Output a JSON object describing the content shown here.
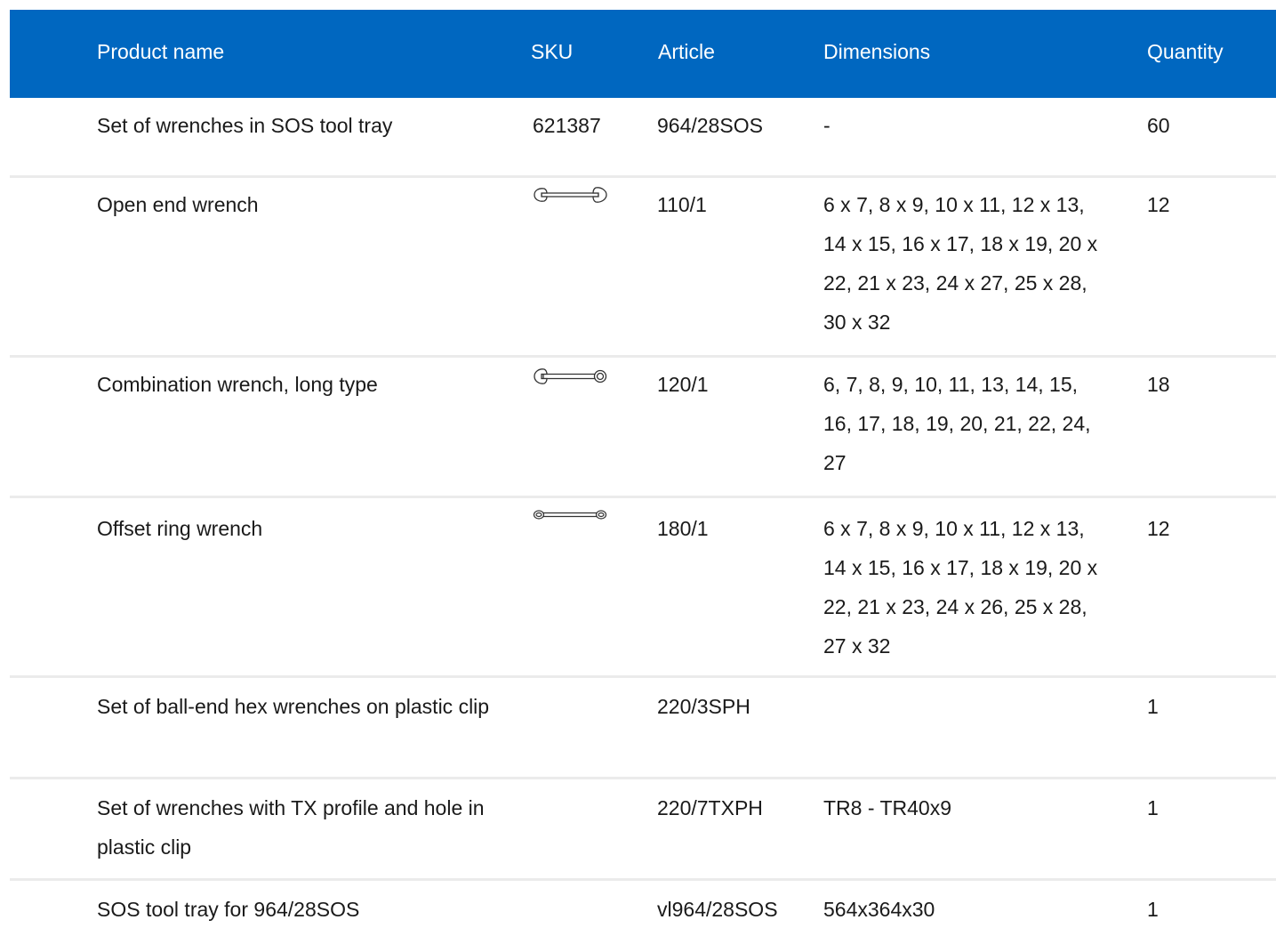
{
  "header": {
    "product_name": "Product name",
    "sku": "SKU",
    "article": "Article",
    "dimensions": "Dimensions",
    "quantity": "Quantity"
  },
  "colors": {
    "header_bg": "#0067c0",
    "header_text": "#ffffff",
    "row_divider": "#ebebeb"
  },
  "rows": [
    {
      "product_name": "Set of wrenches in SOS tool tray",
      "sku": "621387",
      "article": "964/28SOS",
      "dimensions": "-",
      "quantity": "60"
    },
    {
      "product_name": "Open end wrench",
      "sku_icon": "open-end-wrench-icon",
      "article": "110/1",
      "dimensions": "6 x 7, 8 x 9, 10 x 11, 12 x 13, 14 x 15, 16 x 17, 18 x 19, 20 x 22, 21 x 23, 24 x 27, 25 x 28, 30 x 32",
      "quantity": "12"
    },
    {
      "product_name": "Combination wrench, long type",
      "sku_icon": "combination-wrench-icon",
      "article": "120/1",
      "dimensions": "6, 7, 8, 9, 10, 11, 13, 14, 15, 16, 17, 18, 19, 20, 21, 22, 24, 27",
      "quantity": "18"
    },
    {
      "product_name": "Offset ring wrench",
      "sku_icon": "offset-ring-wrench-icon",
      "article": "180/1",
      "dimensions": "6 x 7, 8 x 9, 10 x 11, 12 x 13, 14 x 15, 16 x 17, 18 x 19, 20 x 22, 21 x 23, 24 x 26, 25 x 28, 27 x 32",
      "quantity": "12"
    },
    {
      "product_name": "Set of ball-end hex wrenches on plastic clip",
      "article": "220/3SPH",
      "dimensions": "",
      "quantity": "1"
    },
    {
      "product_name": "Set of wrenches with TX profile and hole in plastic clip",
      "article": "220/7TXPH",
      "dimensions": "TR8 - TR40x9",
      "quantity": "1"
    },
    {
      "product_name": "SOS tool tray for 964/28SOS",
      "article": "vl964/28SOS",
      "dimensions": "564x364x30",
      "quantity": "1"
    }
  ]
}
